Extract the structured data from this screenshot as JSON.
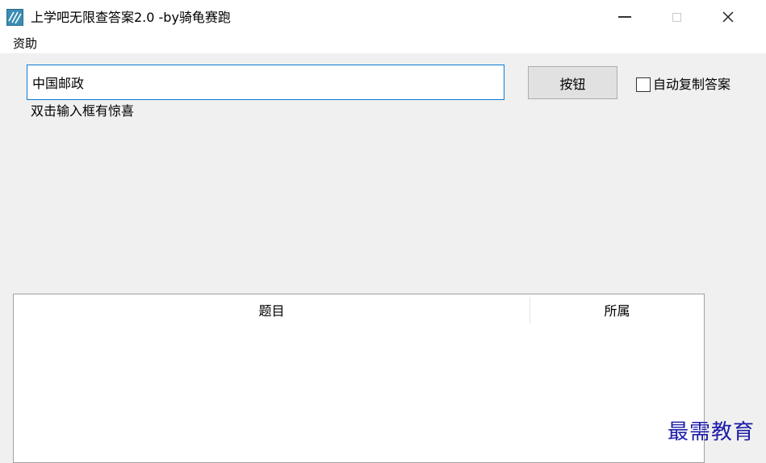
{
  "window": {
    "title": "上学吧无限查答案2.0 -by骑龟赛跑",
    "icon": "app-icon",
    "controls": {
      "minimize": "minimize-icon",
      "maximize": "maximize-icon",
      "close": "close-icon"
    }
  },
  "menu": {
    "items": [
      {
        "label": "资助"
      }
    ]
  },
  "search": {
    "value": "中国邮政",
    "placeholder": ""
  },
  "toolbar": {
    "button_label": "按钮",
    "auto_copy_label": "自动复制答案",
    "auto_copy_checked": false
  },
  "hint": {
    "text": "双击输入框有惊喜"
  },
  "results": {
    "columns": [
      "题目",
      "所属"
    ],
    "rows": []
  },
  "watermark": {
    "text": "最需教育"
  },
  "colors": {
    "accent": "#0a7ad6",
    "watermark": "#1c1ca8",
    "background": "#f0f0f0"
  }
}
